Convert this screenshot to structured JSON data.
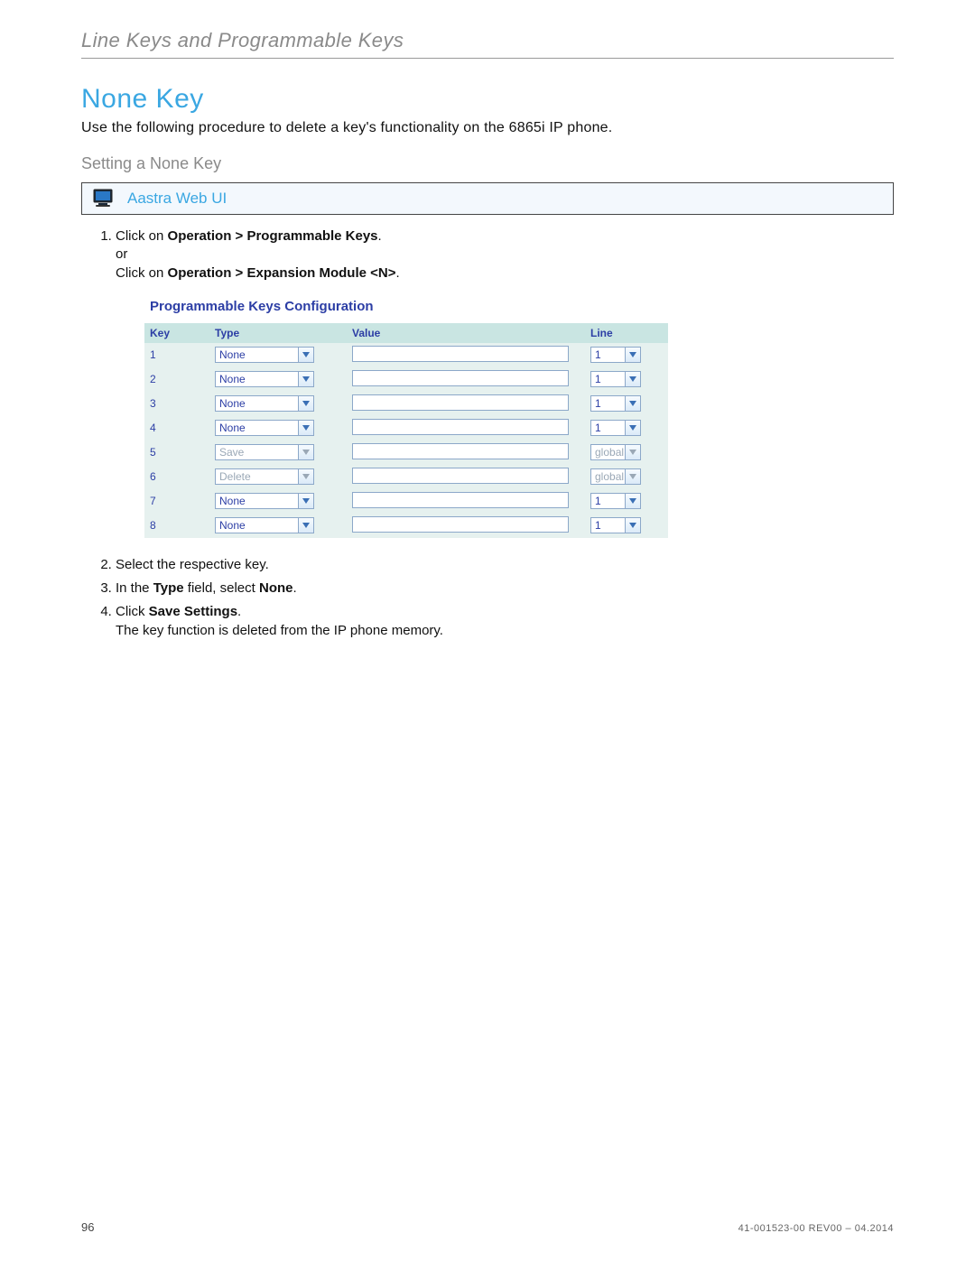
{
  "runningHead": "Line Keys and Programmable Keys",
  "title": "None Key",
  "intro": "Use the following procedure to delete a key's functionality on the 6865i IP phone.",
  "subhead": "Setting a None Key",
  "uiBanner": "Aastra Web UI",
  "step1a": "Click on ",
  "step1b": "Operation > Programmable Keys",
  "step1c": ".",
  "step1or": "or",
  "step1d": "Click on ",
  "step1e": "Operation > Expansion Module <N>",
  "step1f": ".",
  "panelTitle": "Programmable Keys Configuration",
  "cols": {
    "key": "Key",
    "type": "Type",
    "value": "Value",
    "line": "Line"
  },
  "rows": [
    {
      "key": "1",
      "type": "None",
      "line": "1",
      "disabled": false
    },
    {
      "key": "2",
      "type": "None",
      "line": "1",
      "disabled": false
    },
    {
      "key": "3",
      "type": "None",
      "line": "1",
      "disabled": false
    },
    {
      "key": "4",
      "type": "None",
      "line": "1",
      "disabled": false
    },
    {
      "key": "5",
      "type": "Save",
      "line": "global",
      "disabled": true
    },
    {
      "key": "6",
      "type": "Delete",
      "line": "global",
      "disabled": true
    },
    {
      "key": "7",
      "type": "None",
      "line": "1",
      "disabled": false
    },
    {
      "key": "8",
      "type": "None",
      "line": "1",
      "disabled": false
    }
  ],
  "step2": "Select the respective key.",
  "step3a": "In the ",
  "step3b": "Type",
  "step3c": " field, select ",
  "step3d": "None",
  "step3e": ".",
  "step4a": "Click ",
  "step4b": "Save Settings",
  "step4c": ".",
  "step4note": "The key function is deleted from the IP phone memory.",
  "pageNum": "96",
  "docId": "41-001523-00 REV00 – 04.2014"
}
